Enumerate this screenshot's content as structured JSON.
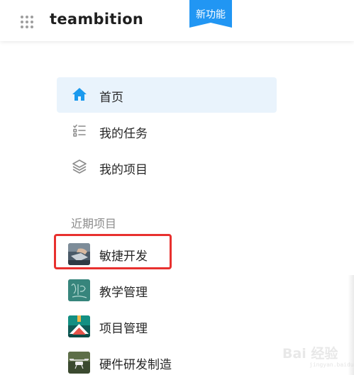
{
  "header": {
    "app_name": "teambition",
    "apps_icon": "grid-dots-icon",
    "new_feature_badge": "新功能",
    "badge_color": "#2196f3"
  },
  "nav": {
    "items": [
      {
        "label": "首页",
        "icon": "home-icon",
        "active": true
      },
      {
        "label": "我的任务",
        "icon": "task-list-icon",
        "active": false
      },
      {
        "label": "我的项目",
        "icon": "layers-icon",
        "active": false
      }
    ],
    "active_bg": "#e9f3fc",
    "active_icon_color": "#1b9aee"
  },
  "recent": {
    "title": "近期项目",
    "projects": [
      {
        "name": "敏捷开发",
        "thumb": "laptop-typing-photo",
        "highlighted": true
      },
      {
        "name": "教学管理",
        "thumb": "chalkboard-photo",
        "highlighted": false
      },
      {
        "name": "项目管理",
        "thumb": "house-roof-icon",
        "highlighted": false
      },
      {
        "name": "硬件研发制造",
        "thumb": "drone-photo",
        "highlighted": false
      }
    ],
    "highlight_color": "#e8302e"
  },
  "watermark": {
    "text": "Bai 经验",
    "sub": "jingyan.baidu.com"
  }
}
